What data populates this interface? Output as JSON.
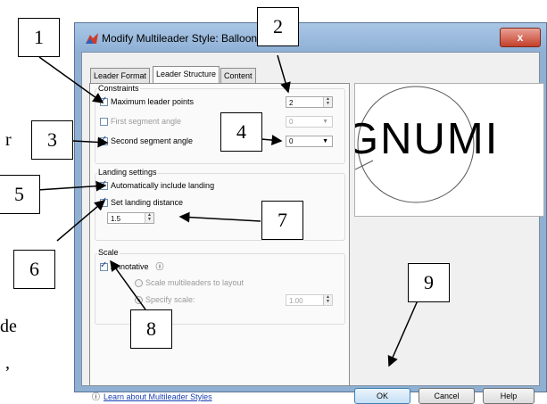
{
  "document_fragments": {
    "letter_r": "r",
    "letters_de": "de",
    "comma": ","
  },
  "dialog": {
    "title": "Modify Multileader Style: Balloons",
    "close_label": "x",
    "tabs": [
      "Leader Format",
      "Leader Structure",
      "Content"
    ],
    "active_tab": "Leader Structure",
    "constraints": {
      "label": "Constraints",
      "max_leader_points": {
        "label": "Maximum leader points",
        "checked": true,
        "value": "2"
      },
      "first_segment_angle": {
        "label": "First segment angle",
        "checked": false,
        "value": "0"
      },
      "second_segment_angle": {
        "label": "Second segment angle",
        "checked": true,
        "value": "0"
      }
    },
    "landing": {
      "label": "Landing settings",
      "auto_include": {
        "label": "Automatically include landing",
        "checked": true
      },
      "set_distance": {
        "label": "Set landing distance",
        "checked": true,
        "value": "1.5"
      }
    },
    "scale": {
      "label": "Scale",
      "annotative": {
        "label": "Annotative",
        "checked": true
      },
      "scale_to_layout": {
        "label": "Scale multileaders to layout",
        "selected": false
      },
      "specify_scale": {
        "label": "Specify scale:",
        "selected": true,
        "value": "1.00"
      }
    },
    "preview_text": "GNUMI",
    "help_link": "Learn about Multileader Styles",
    "buttons": {
      "ok": "OK",
      "cancel": "Cancel",
      "help": "Help"
    }
  },
  "callouts": [
    "1",
    "2",
    "3",
    "4",
    "5",
    "6",
    "7",
    "8",
    "9"
  ],
  "colors": {
    "title_bar": "#a9c6e5",
    "link": "#1a3fb5",
    "close_button": "#c4402a"
  }
}
